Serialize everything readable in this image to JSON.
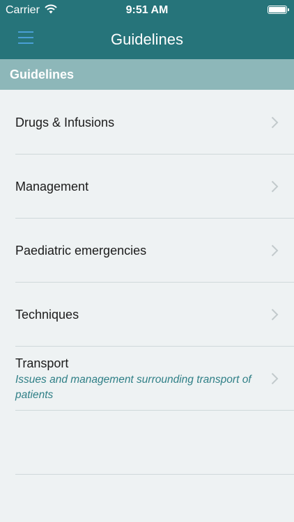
{
  "status_bar": {
    "carrier": "Carrier",
    "time": "9:51 AM"
  },
  "nav": {
    "title": "Guidelines",
    "menu_icon": "hamburger-menu-icon"
  },
  "section": {
    "label": "Guidelines"
  },
  "list": {
    "items": [
      {
        "label": "Drugs & Infusions"
      },
      {
        "label": "Management"
      },
      {
        "label": "Paediatric emergencies"
      },
      {
        "label": "Techniques"
      },
      {
        "label": "Transport",
        "subtitle": "Issues and management surrounding transport of patients"
      }
    ]
  },
  "colors": {
    "header": "#26747a",
    "section": "#8db7b9",
    "accent": "#2f7f86",
    "menu": "#4a9fd6"
  }
}
